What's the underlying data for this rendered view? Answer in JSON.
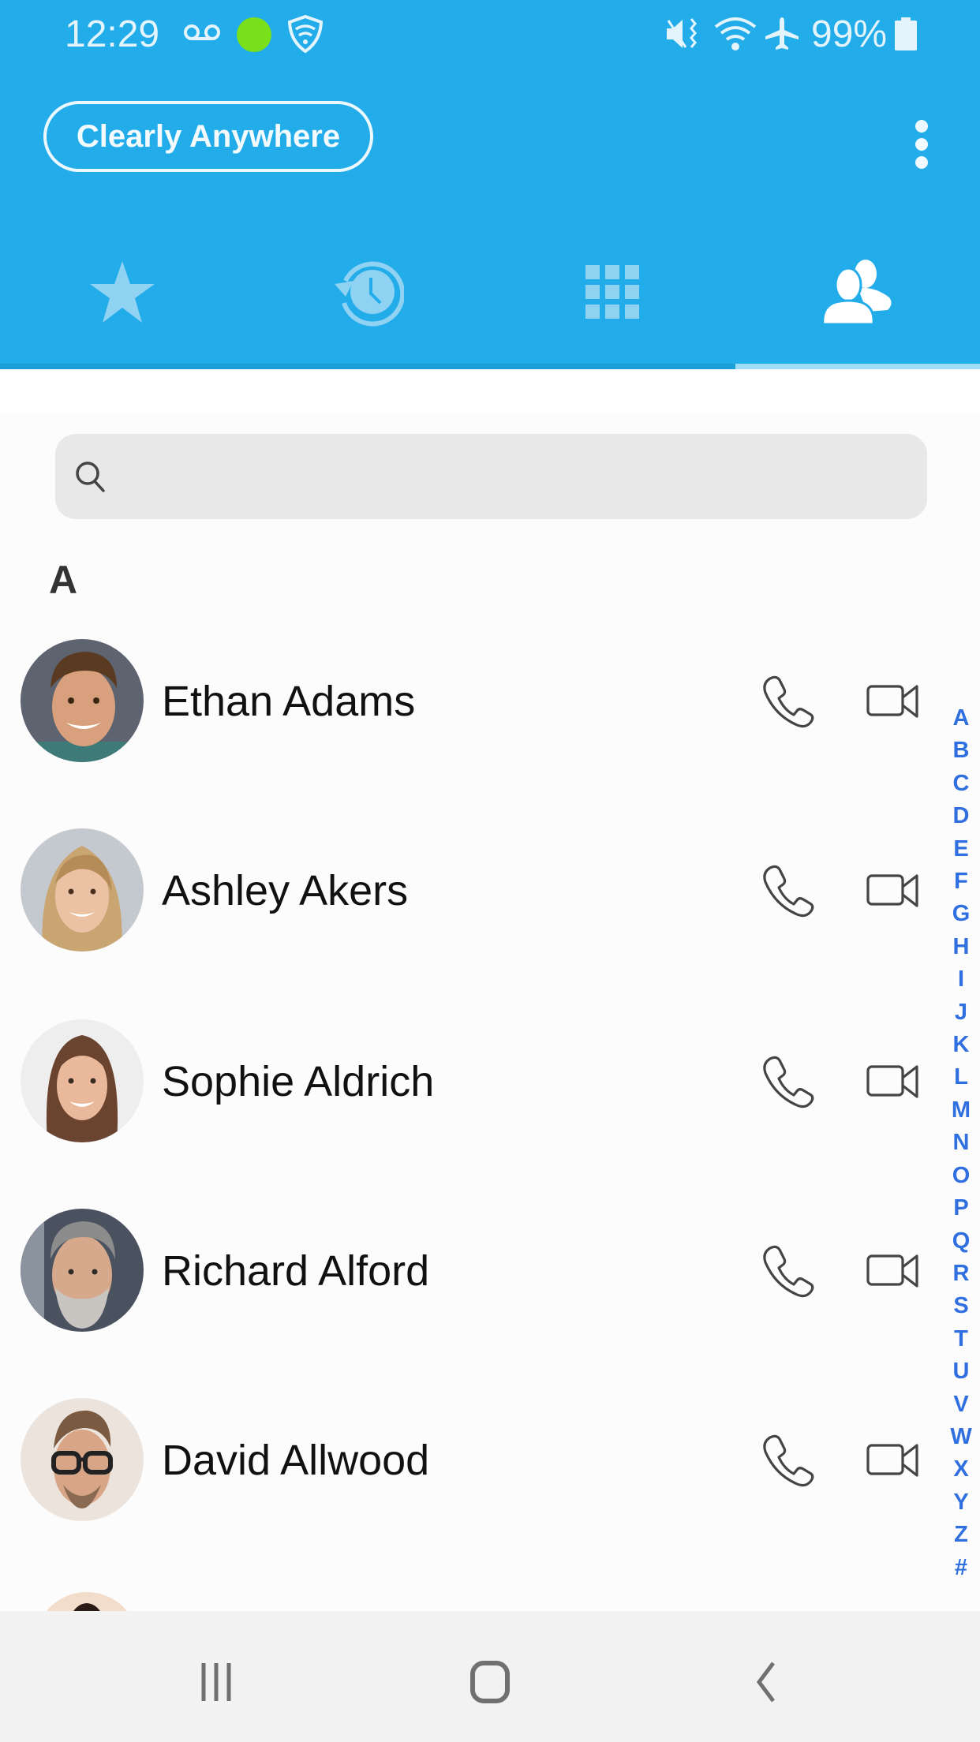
{
  "status_bar": {
    "time": "12:29",
    "battery_percent": "99%",
    "icons": [
      "voicemail-icon",
      "green-dot-indicator",
      "vpn-shield-icon",
      "mute-vibrate-icon",
      "wifi-icon",
      "airplane-mode-icon",
      "battery-icon"
    ]
  },
  "header": {
    "brand_label": "Clearly Anywhere",
    "more_menu_icon": "more-vertical-icon",
    "accent_color": "#22acea"
  },
  "tabs": [
    {
      "name": "favorites",
      "icon": "star-icon",
      "active": false
    },
    {
      "name": "recents",
      "icon": "history-icon",
      "active": false
    },
    {
      "name": "dialpad",
      "icon": "dialpad-icon",
      "active": false
    },
    {
      "name": "contacts",
      "icon": "contacts-icon",
      "active": true
    }
  ],
  "search": {
    "value": "",
    "placeholder": ""
  },
  "contacts": {
    "section_letter": "A",
    "items": [
      {
        "name": "Ethan Adams"
      },
      {
        "name": "Ashley Akers"
      },
      {
        "name": "Sophie Aldrich"
      },
      {
        "name": "Richard Alford"
      },
      {
        "name": "David Allwood"
      }
    ]
  },
  "alpha_index": [
    "A",
    "B",
    "C",
    "D",
    "E",
    "F",
    "G",
    "H",
    "I",
    "J",
    "K",
    "L",
    "M",
    "N",
    "O",
    "P",
    "Q",
    "R",
    "S",
    "T",
    "U",
    "V",
    "W",
    "X",
    "Y",
    "Z",
    "#"
  ],
  "nav_bar": {
    "buttons": [
      "recent-apps",
      "home",
      "back"
    ]
  }
}
